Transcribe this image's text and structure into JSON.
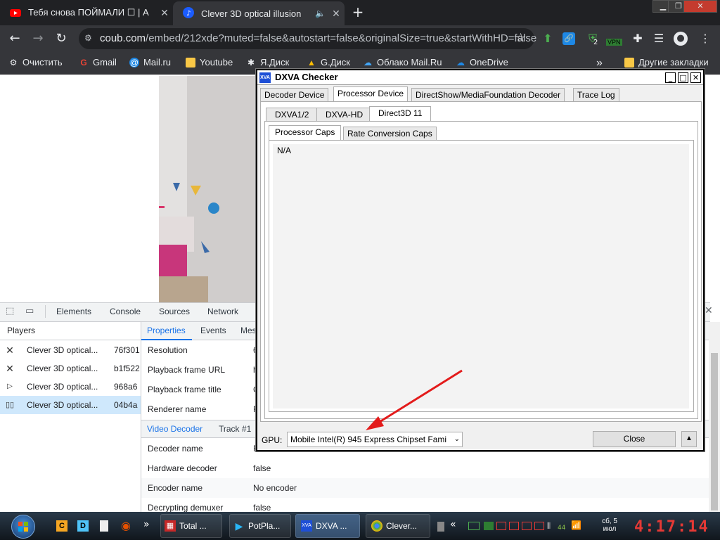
{
  "colors": {
    "accent": "#1a73e8",
    "dark": "#202124",
    "toolbar": "#35363a",
    "selected_row": "#cfe8fc",
    "arrow": "#e31b1b",
    "clock": "#e53935"
  },
  "browser": {
    "tabs": [
      {
        "title": "Тебя снова ПОЙМАЛИ ☐ | А",
        "icon": "youtube-icon"
      },
      {
        "title": "Clever 3D optical illusion",
        "icon": "coub-icon"
      }
    ],
    "new_tab": "+",
    "url_host": "coub.com",
    "url_path": "/embed/212xde?muted=false&autostart=false&originalSize=true&startWithHD=false",
    "bookmarks": [
      {
        "label": "Очистить",
        "icon": "gear-icon"
      },
      {
        "label": "Gmail",
        "icon": "google-icon"
      },
      {
        "label": "Mail.ru",
        "icon": "mail-icon"
      },
      {
        "label": "Youtube",
        "icon": "folder-icon"
      },
      {
        "label": "Я.Диск",
        "icon": "yandex-icon"
      },
      {
        "label": "G.Диск",
        "icon": "gdrive-icon"
      },
      {
        "label": "Облако Mail.Ru",
        "icon": "cloud-icon"
      },
      {
        "label": "OneDrive",
        "icon": "onedrive-icon"
      }
    ],
    "other_bookmarks": "Другие закладки",
    "more": "»",
    "badge": "2",
    "vpn": "VPN"
  },
  "devtools": {
    "tabs": [
      "Elements",
      "Console",
      "Sources",
      "Network"
    ],
    "players_header": "Players",
    "players": [
      {
        "name": "Clever 3D optical...",
        "id": "76f301",
        "icon": "close-icon"
      },
      {
        "name": "Clever 3D optical...",
        "id": "b1f522",
        "icon": "close-icon"
      },
      {
        "name": "Clever 3D optical...",
        "id": "968a6",
        "icon": "play-icon"
      },
      {
        "name": "Clever 3D optical...",
        "id": "04b4a",
        "icon": "pause-icon"
      }
    ],
    "prop_tabs": [
      "Properties",
      "Events",
      "Mes"
    ],
    "properties": [
      {
        "k": "Resolution",
        "v": "6"
      },
      {
        "k": "Playback frame URL",
        "v": "h"
      },
      {
        "k": "Playback frame title",
        "v": "C"
      },
      {
        "k": "Renderer name",
        "v": "R"
      }
    ],
    "decoder_tabs": [
      "Video Decoder",
      "Track #1"
    ],
    "decoder_props": [
      {
        "k": "Decoder name",
        "v": "F"
      },
      {
        "k": "Hardware decoder",
        "v": "false"
      },
      {
        "k": "Encoder name",
        "v": "No encoder"
      },
      {
        "k": "Decrypting demuxer",
        "v": "false"
      }
    ]
  },
  "dxva": {
    "title": "DXVA Checker",
    "app_icon": "XVA",
    "main_tabs": [
      "Decoder Device",
      "Processor Device",
      "DirectShow/MediaFoundation Decoder",
      "Trace Log"
    ],
    "api_tabs": [
      "DXVA1/2",
      "DXVA-HD",
      "Direct3D 11"
    ],
    "caps_tabs": [
      "Processor Caps",
      "Rate Conversion Caps"
    ],
    "content": "N/A",
    "gpu_label": "GPU:",
    "gpu_value": "Mobile Intel(R) 945 Express Chipset Fami",
    "close": "Close"
  },
  "taskbar": {
    "items": [
      {
        "label": "Total ...",
        "icon": "total-commander-icon"
      },
      {
        "label": "PotPla...",
        "icon": "potplayer-icon"
      },
      {
        "label": "DXVA ...",
        "icon": "dxva-icon"
      },
      {
        "label": "Clever...",
        "icon": "chrome-icon"
      }
    ],
    "tray_count": "44",
    "date_line1": "сб, 5",
    "date_line2": "июл",
    "clock": "4:17:14"
  }
}
